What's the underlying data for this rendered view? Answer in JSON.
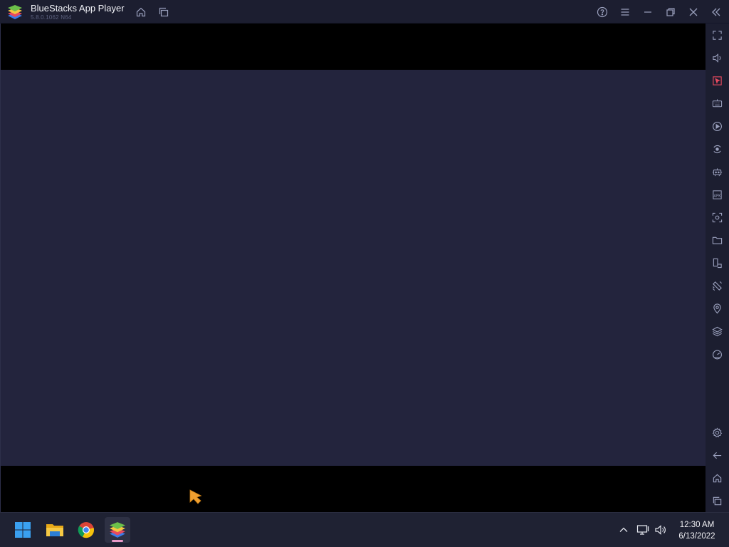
{
  "window": {
    "title": "BlueStacks App Player",
    "version": "5.8.0.1062 N64"
  },
  "titlebar_buttons": {
    "home": "home-icon",
    "multi_instance": "multi-instance-icon",
    "help": "help-icon",
    "menu": "menu-icon",
    "minimize": "minimize-icon",
    "restore": "restore-icon",
    "close": "close-icon",
    "collapse_sidebar": "double-chevron-left-icon"
  },
  "sidebar": {
    "items": [
      "fullscreen-icon",
      "volume-icon",
      "pointer-lock-icon",
      "keyboard-controls-icon",
      "macro-recorder-icon",
      "sync-instance-icon",
      "game-controls-icon",
      "install-apk-icon",
      "screenshot-icon",
      "media-folder-icon",
      "rotate-icon",
      "shake-icon",
      "location-icon",
      "layers-icon",
      "eco-mode-icon",
      "settings-icon",
      "back-icon",
      "android-home-icon",
      "recent-apps-icon"
    ]
  },
  "taskbar": {
    "apps": [
      "windows-start-icon",
      "file-explorer-icon",
      "chrome-icon",
      "bluestacks-icon"
    ],
    "tray": [
      "show-hidden-icons-icon",
      "network-icon",
      "speaker-icon"
    ],
    "time": "12:30 AM",
    "date": "6/13/2022"
  },
  "colors": {
    "display_bg": "#23243d",
    "chrome_bg": "#1c1e30",
    "taskbar_bg": "#1f2233",
    "cursor": "#f0a030",
    "active_indicator": "#e899c8"
  }
}
